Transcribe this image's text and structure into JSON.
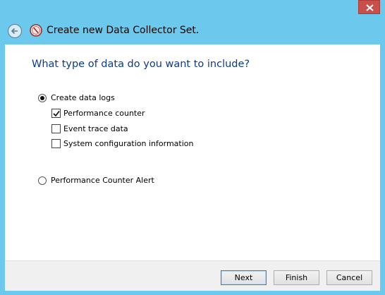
{
  "window": {
    "title": "Create new Data Collector Set."
  },
  "icons": {
    "back": "back-arrow-icon",
    "app": "data-collector-icon",
    "close": "close-icon"
  },
  "page": {
    "question": "What type of data do you want to include?",
    "options": {
      "create_logs": {
        "label": "Create data logs",
        "selected": true
      },
      "perf_counter": {
        "label": "Performance counter",
        "checked": true
      },
      "event_trace": {
        "label": "Event trace data",
        "checked": false
      },
      "sys_config": {
        "label": "System configuration information",
        "checked": false
      },
      "perf_alert": {
        "label": "Performance Counter Alert",
        "selected": false
      }
    }
  },
  "footer": {
    "next_label": "Next",
    "finish_label": "Finish",
    "cancel_label": "Cancel"
  },
  "colors": {
    "frame": "#6ac9ec",
    "question_text": "#0c3b8c",
    "close_button": "#c7504b"
  }
}
